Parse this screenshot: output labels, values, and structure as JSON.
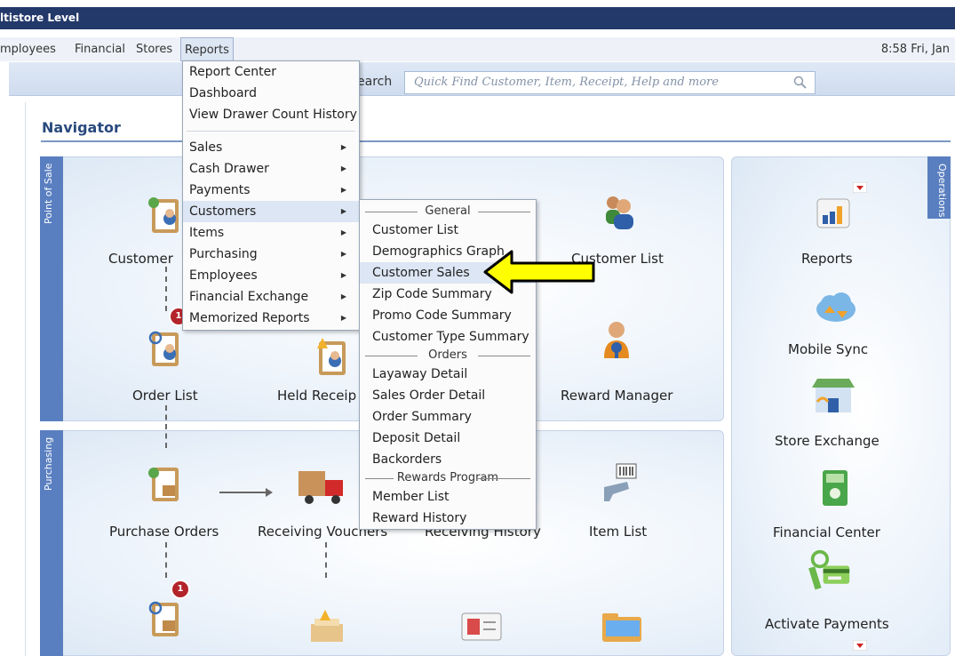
{
  "window": {
    "title": "ltistore Level"
  },
  "menubar": {
    "items": [
      "mployees",
      "Financial",
      "Stores",
      "Reports"
    ],
    "clock": "8:58 Fri, Jan"
  },
  "search": {
    "label": "earch",
    "placeholder": "Quick Find Customer, Item, Receipt, Help and more"
  },
  "navigator": {
    "title": "Navigator"
  },
  "tabs": {
    "point_of_sale": "Point of Sale",
    "purchasing": "Purchasing",
    "operations": "Operations"
  },
  "pos_icons": {
    "customer": "Customer",
    "customer_list": "Customer List",
    "order_list": "Order List",
    "held_receipts": "Held Receip",
    "reward_manager": "Reward Manager"
  },
  "purchasing_icons": {
    "purchase_orders": "Purchase Orders",
    "receiving_vouchers": "Receiving Vouchers",
    "receiving_history": "Receiving History",
    "item_list": "Item List"
  },
  "operations_icons": {
    "reports": "Reports",
    "mobile_sync": "Mobile Sync",
    "store_exchange": "Store Exchange",
    "financial_center": "Financial Center",
    "activate_payments": "Activate Payments"
  },
  "badges": {
    "order": "1",
    "purchase": "1"
  },
  "reports_menu": {
    "top": [
      "Report Center",
      "Dashboard",
      "View Drawer Count History"
    ],
    "sub": [
      "Sales",
      "Cash Drawer",
      "Payments",
      "Customers",
      "Items",
      "Purchasing",
      "Employees",
      "Financial Exchange",
      "Memorized Reports"
    ]
  },
  "customers_menu": {
    "general_header": "General",
    "general": [
      "Customer List",
      "Demographics Graph",
      "Customer Sales",
      "Zip Code Summary",
      "Promo Code Summary",
      "Customer Type Summary"
    ],
    "orders_header": "Orders",
    "orders": [
      "Layaway Detail",
      "Sales Order Detail",
      "Order Summary",
      "Deposit Detail",
      "Backorders"
    ],
    "rewards_header": "Rewards Program",
    "rewards": [
      "Member List",
      "Reward History"
    ]
  },
  "colors": {
    "title_bar": "#23396a",
    "tab_blue": "#5a7fc0",
    "arrow_yellow": "#ffff00"
  }
}
